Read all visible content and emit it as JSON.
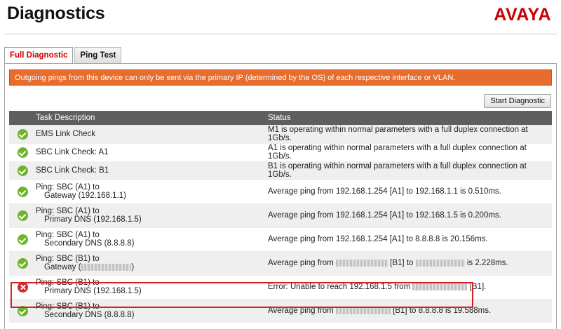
{
  "header": {
    "title": "Diagnostics",
    "brand": "AVAYA"
  },
  "tabs": [
    {
      "label": "Full Diagnostic",
      "active": true
    },
    {
      "label": "Ping Test",
      "active": false
    }
  ],
  "banner": {
    "text": "Outgoing pings from this device can only be sent via the primary IP (determined by the OS) of each respective interface or VLAN."
  },
  "toolbar": {
    "start_label": "Start Diagnostic"
  },
  "table": {
    "columns": [
      "Task Description",
      "Status"
    ],
    "rows": [
      {
        "status": "ok",
        "task": "EMS Link Check",
        "result": "M1 is operating within normal parameters with a full duplex connection at 1Gb/s."
      },
      {
        "status": "ok",
        "task": "SBC Link Check: A1",
        "result": "A1 is operating within normal parameters with a full duplex connection at 1Gb/s."
      },
      {
        "status": "ok",
        "task": "SBC Link Check: B1",
        "result": "B1 is operating within normal parameters with a full duplex connection at 1Gb/s."
      },
      {
        "status": "ok",
        "task_line1": "Ping: SBC (A1) to",
        "task_line2": "Gateway (192.168.1.1)",
        "result": "Average ping from 192.168.1.254 [A1] to 192.168.1.1 is 0.510ms."
      },
      {
        "status": "ok",
        "task_line1": "Ping: SBC (A1) to",
        "task_line2": "Primary DNS (192.168.1.5)",
        "result": "Average ping from 192.168.1.254 [A1] to 192.168.1.5 is 0.200ms."
      },
      {
        "status": "ok",
        "task_line1": "Ping: SBC (A1) to",
        "task_line2": "Secondary DNS (8.8.8.8)",
        "result": "Average ping from 192.168.1.254 [A1] to 8.8.8.8 is 20.156ms."
      },
      {
        "status": "ok",
        "task_line1": "Ping: SBC (B1) to",
        "task_line2_prefix": "Gateway (",
        "task_line2_suffix": ")",
        "result_prefix": "Average ping from",
        "result_mid": "[B1] to",
        "result_suffix": "is 2.228ms."
      },
      {
        "status": "error",
        "task_line1": "Ping: SBC (B1) to",
        "task_line2": "Primary DNS (192.168.1.5)",
        "result_prefix": "Error: Unable to reach 192.168.1.5 from",
        "result_suffix": "[B1]."
      },
      {
        "status": "ok",
        "task_line1": "Ping: SBC (B1) to",
        "task_line2": "Secondary DNS (8.8.8.8)",
        "result_prefix": "Average ping from",
        "result_suffix": "[B1] to 8.8.8.8 is 19.588ms."
      }
    ]
  },
  "colors": {
    "brand": "#cc0000",
    "banner": "#e76d2e",
    "header_row": "#5f5f5f",
    "ok": "#6fb329",
    "error": "#d62a2a",
    "highlight_border": "#d61f26"
  },
  "icons": {
    "ok": "check-circle-icon",
    "error": "x-circle-icon"
  }
}
